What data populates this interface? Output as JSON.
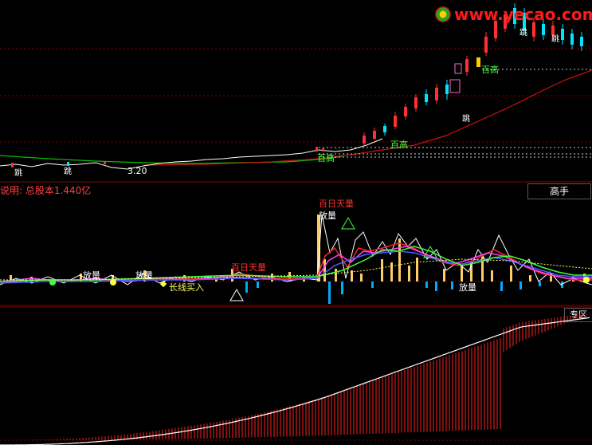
{
  "logo": {
    "text": "www.yecao.com"
  },
  "main_chart": {
    "low_label": "3.20",
    "jump_marks": [
      "跳",
      "跳",
      "跳",
      "跳",
      "跳"
    ],
    "high_marks": [
      "百高",
      "百高",
      "百高"
    ]
  },
  "info_bar": {
    "text": "说明: 总股本1.440亿"
  },
  "buttons": {
    "master": "高手",
    "zone": "专区"
  },
  "volume_chart": {
    "labels": {
      "hundred_day_vol_a": "百日天量",
      "hundred_day_vol_b": "百日天量",
      "fang_liang_1": "放量",
      "fang_liang_2": "放量",
      "fang_liang_3": "放量",
      "fang_liang_4": "放量",
      "long_term_buy": "长线买入"
    }
  },
  "colors": {
    "background": "#000000",
    "grid": "#8b0000",
    "up": "#ff3030",
    "down": "#00e5ff",
    "ma_green": "#00c000",
    "ma_red": "#cc1010",
    "label_yellow": "#ffff00",
    "label_green": "#40ff40"
  }
}
